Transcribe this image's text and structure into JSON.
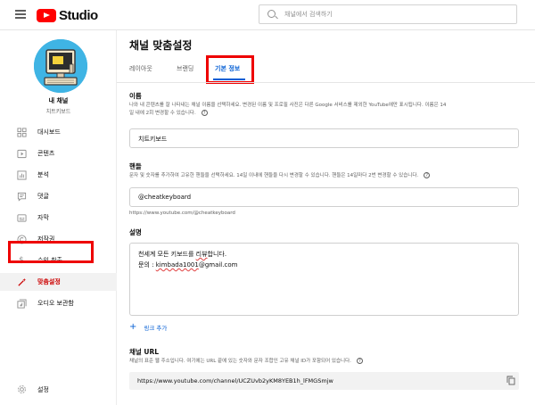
{
  "header": {
    "app_name": "Studio",
    "search_placeholder": "채널에서 검색하기"
  },
  "channel": {
    "name": "내 채널",
    "handle_label": "치트키보드"
  },
  "sidebar": {
    "items": [
      {
        "label": "대시보드",
        "icon": "dashboard-icon"
      },
      {
        "label": "콘텐츠",
        "icon": "content-icon"
      },
      {
        "label": "분석",
        "icon": "analytics-icon"
      },
      {
        "label": "댓글",
        "icon": "comments-icon"
      },
      {
        "label": "자막",
        "icon": "subtitles-icon"
      },
      {
        "label": "저작권",
        "icon": "copyright-icon"
      },
      {
        "label": "수익 창출",
        "icon": "monetization-icon"
      },
      {
        "label": "맞춤설정",
        "icon": "customization-icon",
        "active": true
      },
      {
        "label": "오디오 보관함",
        "icon": "audio-library-icon"
      }
    ],
    "settings_label": "설정"
  },
  "main": {
    "title": "채널 맞춤설정",
    "tabs": [
      {
        "label": "레이아웃"
      },
      {
        "label": "브랜딩"
      },
      {
        "label": "기본 정보",
        "active": true
      }
    ],
    "name_section": {
      "title": "이름",
      "desc_line1": "나와 내 콘텐츠를 잘 나타내는 채널 이름을 선택하세요. 변경된 이름 및 프로필 사진은 다른 Google 서비스를 제외한 YouTube에만 표시됩니다. 이름은 14",
      "desc_line2": "일 내에 2회 변경할 수 있습니다.",
      "value": "치트키보드"
    },
    "handle_section": {
      "title": "핸들",
      "desc": "문자 및 숫자를 추가하여 고유한 핸들을 선택하세요. 14일 이내에 핸들을 다시 변경할 수 있습니다. 핸들은 14일마다 2번 변경할 수 있습니다.",
      "value": "@cheatkeyboard",
      "url": "https://www.youtube.com/@cheatkeyboard"
    },
    "description_section": {
      "title": "설명",
      "line1_prefix": "천세계 모든 키보드를 ",
      "line1_underlined": "리뷰",
      "line1_suffix": "합니다.",
      "line2_prefix": "문의 : ",
      "line2_underlined": "kimbada1001",
      "line2_suffix": "@gmail.com"
    },
    "add_link_label": "링크 추가",
    "channel_url_section": {
      "title": "채널 URL",
      "desc": "채널의 표준 웹 주소입니다. 여기에는 URL 끝에 있는 숫자와 문자 조합인 고유 채널 ID가 포함되어 있습니다.",
      "value": "https://www.youtube.com/channel/UCZUvb2yKM8YEB1h_lFMGSmjw"
    }
  },
  "colors": {
    "youtube_red": "#ff0000",
    "highlight_box": "#ee0000",
    "accent_blue": "#065fd4",
    "avatar_bg": "#3fb4e4"
  }
}
